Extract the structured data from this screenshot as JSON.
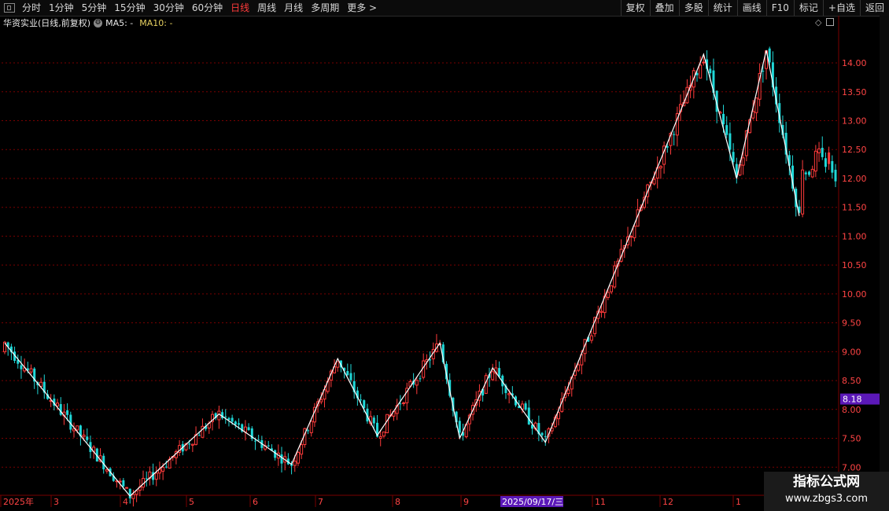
{
  "toolbar": {
    "left": [
      "分时",
      "1分钟",
      "5分钟",
      "15分钟",
      "30分钟",
      "60分钟",
      "日线",
      "周线",
      "月线",
      "多周期",
      "更多 >"
    ],
    "right": [
      "复权",
      "叠加",
      "多股",
      "统计",
      "画线",
      "F10",
      "标记",
      "+自选",
      "返回"
    ],
    "active": "日线"
  },
  "info": {
    "stock_name": "华资实业(日线,前复权)",
    "ma5": "MA5: -",
    "ma10": "MA10: -"
  },
  "price_axis": {
    "labels": [
      "14.00",
      "13.50",
      "13.00",
      "12.50",
      "12.00",
      "11.50",
      "11.00",
      "10.50",
      "10.00",
      "9.50",
      "9.00",
      "8.50",
      "8.00",
      "7.50",
      "7.00"
    ]
  },
  "current_price": {
    "label": "8.18",
    "value": 8.18,
    "color": "#5b18b8"
  },
  "date_axis": {
    "labels": [
      "2025年",
      "3",
      "4",
      "5",
      "6",
      "7",
      "8",
      "9",
      "11",
      "12",
      "1"
    ],
    "highlight": "2025/09/17/三"
  },
  "watermark": {
    "line1": "指标公式网",
    "line2": "www.zbgs3.com"
  },
  "colors": {
    "up": "#ff3b3b",
    "down": "#20d8d8",
    "zigzag": "#ffffff",
    "grid": "#7a0000"
  },
  "chart_data": {
    "type": "candlestick",
    "ylim": [
      6.6,
      14.3
    ],
    "zigzag": [
      {
        "i": 0,
        "p": 9.15
      },
      {
        "i": 38,
        "p": 6.5
      },
      {
        "i": 65,
        "p": 7.92
      },
      {
        "i": 87,
        "p": 7.05
      },
      {
        "i": 101,
        "p": 8.88
      },
      {
        "i": 113,
        "p": 7.55
      },
      {
        "i": 132,
        "p": 9.15
      },
      {
        "i": 138,
        "p": 7.5
      },
      {
        "i": 148,
        "p": 8.72
      },
      {
        "i": 164,
        "p": 7.43
      },
      {
        "i": 212,
        "p": 14.15
      },
      {
        "i": 222,
        "p": 12.0
      },
      {
        "i": 231,
        "p": 14.22
      },
      {
        "i": 241,
        "p": 11.35
      }
    ]
  }
}
